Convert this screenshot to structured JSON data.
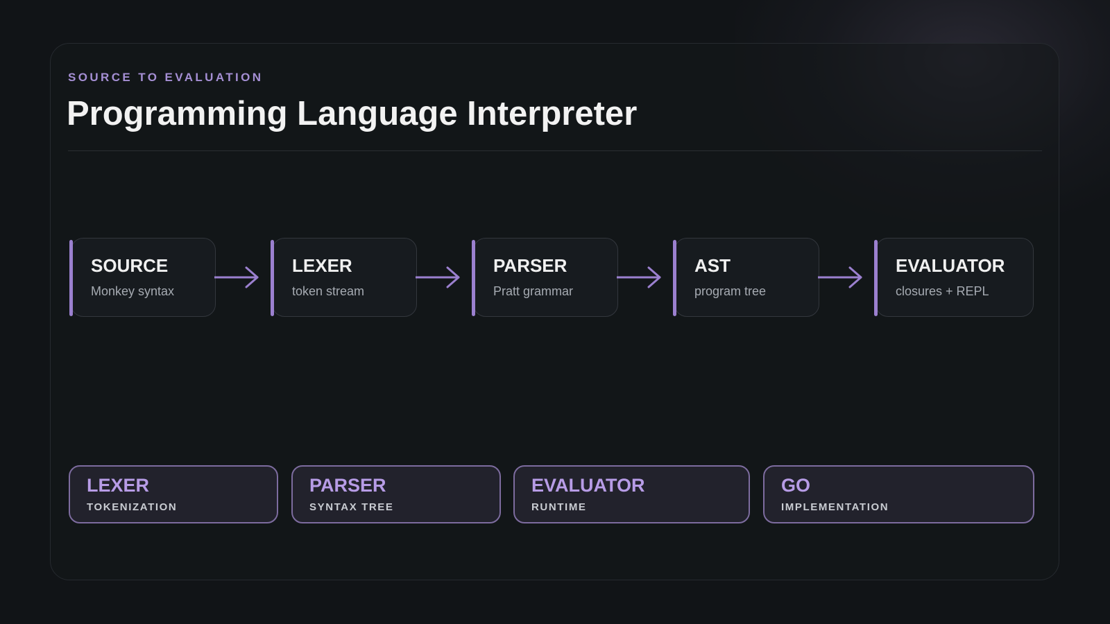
{
  "header": {
    "eyebrow": "SOURCE TO EVALUATION",
    "title": "Programming Language Interpreter"
  },
  "pipeline": {
    "stages": [
      {
        "name": "SOURCE",
        "sub": "Monkey syntax"
      },
      {
        "name": "LEXER",
        "sub": "token stream"
      },
      {
        "name": "PARSER",
        "sub": "Pratt grammar"
      },
      {
        "name": "AST",
        "sub": "program tree"
      },
      {
        "name": "EVALUATOR",
        "sub": "closures + REPL"
      }
    ]
  },
  "tags": [
    {
      "name": "LEXER",
      "sub": "TOKENIZATION"
    },
    {
      "name": "PARSER",
      "sub": "SYNTAX TREE"
    },
    {
      "name": "EVALUATOR",
      "sub": "RUNTIME"
    },
    {
      "name": "GO",
      "sub": "IMPLEMENTATION"
    }
  ],
  "colors": {
    "accent": "#9b80cf",
    "background": "#111417",
    "text": "#f0f0f0"
  }
}
